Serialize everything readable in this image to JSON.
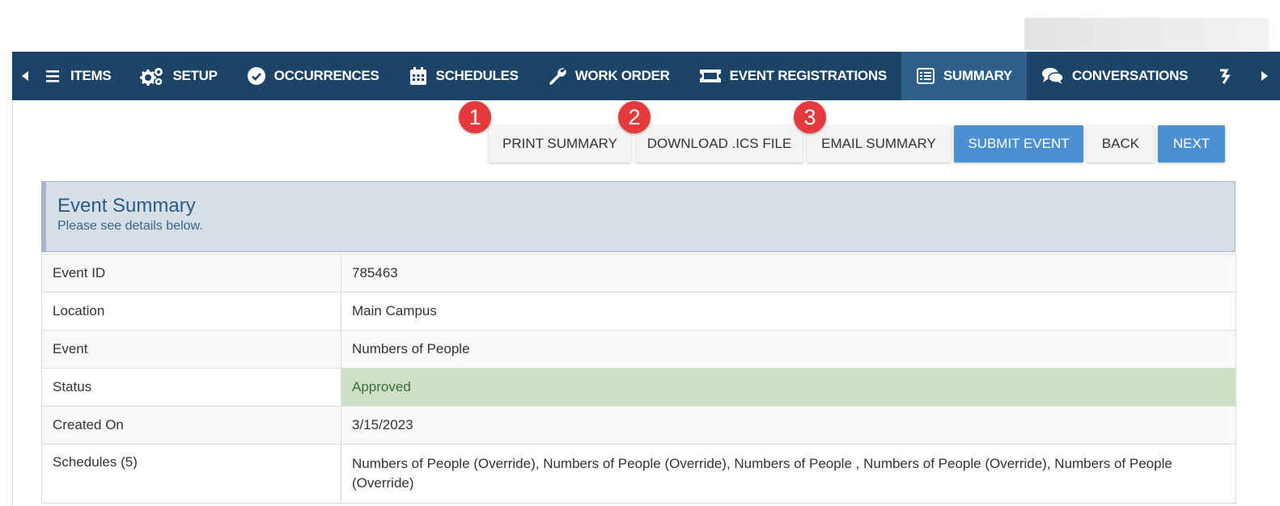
{
  "nav": {
    "tabs": [
      {
        "label": "ITEMS",
        "icon": "list-icon"
      },
      {
        "label": "SETUP",
        "icon": "gears-icon"
      },
      {
        "label": "OCCURRENCES",
        "icon": "check-circle-icon"
      },
      {
        "label": "SCHEDULES",
        "icon": "calendar-icon"
      },
      {
        "label": "WORK ORDER",
        "icon": "wrench-icon"
      },
      {
        "label": "EVENT REGISTRATIONS",
        "icon": "ticket-icon"
      },
      {
        "label": "SUMMARY",
        "icon": "list-alt-icon",
        "active": true
      },
      {
        "label": "CONVERSATIONS",
        "icon": "comments-icon"
      }
    ]
  },
  "toolbar": {
    "print_label": "PRINT SUMMARY",
    "download_label": "DOWNLOAD .ICS FILE",
    "email_label": "EMAIL SUMMARY",
    "submit_label": "SUBMIT EVENT",
    "back_label": "BACK",
    "next_label": "NEXT",
    "badges": [
      "1",
      "2",
      "3"
    ]
  },
  "summary": {
    "title": "Event Summary",
    "subtitle": "Please see details below.",
    "rows": [
      {
        "label": "Event ID",
        "value": "785463"
      },
      {
        "label": "Location",
        "value": "Main Campus"
      },
      {
        "label": "Event",
        "value": "Numbers of People"
      },
      {
        "label": "Status",
        "value": "Approved"
      },
      {
        "label": "Created On",
        "value": "3/15/2023"
      },
      {
        "label": "Schedules (5)",
        "value": "Numbers of People (Override), Numbers of People (Override), Numbers of People , Numbers of People (Override), Numbers of People (Override)"
      }
    ]
  },
  "colors": {
    "navbar": "#1c4466",
    "active_tab": "#2d5f88",
    "primary_button": "#4d90d1",
    "badge": "#e6393b",
    "approved": "#cde0c5"
  }
}
